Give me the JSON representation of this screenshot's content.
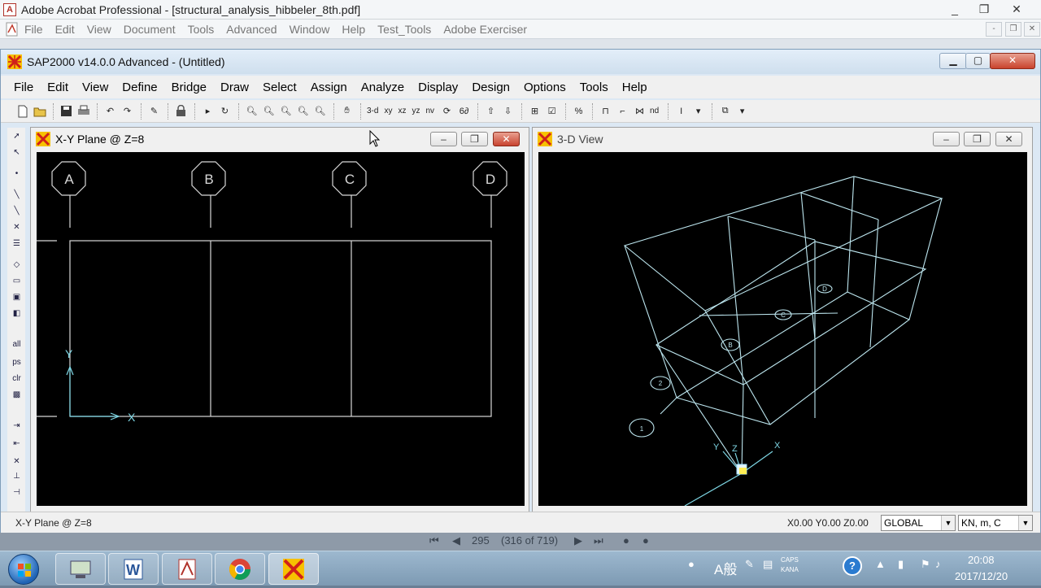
{
  "acrobat": {
    "title": "Adobe Acrobat Professional - [structural_analysis_hibbeler_8th.pdf]",
    "menu": [
      "File",
      "Edit",
      "View",
      "Document",
      "Tools",
      "Advanced",
      "Window",
      "Help",
      "Test_Tools",
      "Adobe Exerciser"
    ],
    "nav": {
      "page_value": "295",
      "page_of": "(316 of 719)"
    }
  },
  "sap": {
    "title": "SAP2000 v14.0.0 Advanced  - (Untitled)",
    "menu": [
      "File",
      "Edit",
      "View",
      "Define",
      "Bridge",
      "Draw",
      "Select",
      "Assign",
      "Analyze",
      "Display",
      "Design",
      "Options",
      "Tools",
      "Help"
    ],
    "toolbar_text": {
      "view_3d": "3-d",
      "view_xy": "xy",
      "view_xz": "xz",
      "view_yz": "yz",
      "view_nv": "nv",
      "nd": "nd"
    },
    "left_tool_labels": {
      "all": "all",
      "ps": "ps",
      "clr": "clr"
    }
  },
  "xy_pane": {
    "title": "X-Y Plane @ Z=8",
    "grid_bubbles": [
      "A",
      "B",
      "C",
      "D"
    ],
    "axis_x": "X",
    "axis_y": "Y"
  },
  "view3d_pane": {
    "title": "3-D View",
    "axis_x": "X",
    "axis_y": "Y",
    "axis_z": "Z",
    "grid_bubbles": [
      "D",
      "C",
      "B",
      "2",
      "1"
    ]
  },
  "status": {
    "left_text": "X-Y Plane @ Z=8",
    "coords": "X0.00  Y0.00  Z0.00",
    "coord_system": "GLOBAL",
    "units": "KN, m, C"
  },
  "taskbar": {
    "ime": "A般",
    "caps": "CAPS",
    "kana": "KANA",
    "time": "20:08",
    "date": "2017/12/20"
  },
  "colors": {
    "grid_line": "#d8d8d8",
    "view3d_line": "#bde6ef",
    "axis": "#7fd8e6",
    "titlebar": "#dce8f4"
  }
}
